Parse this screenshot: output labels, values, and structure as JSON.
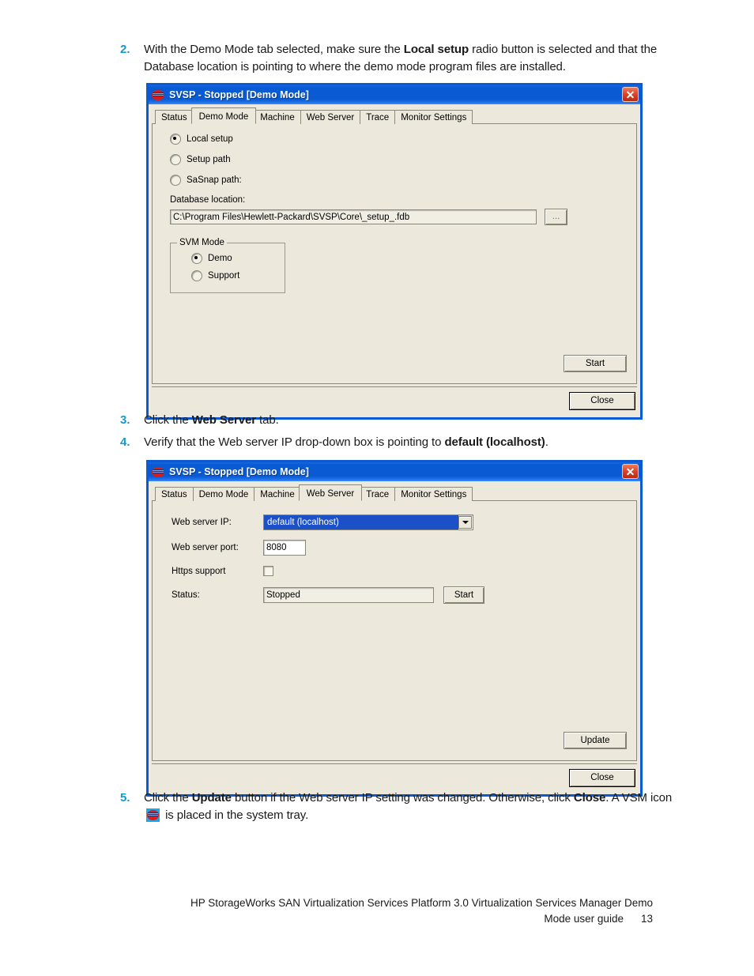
{
  "document": {
    "steps": [
      {
        "number": "2.",
        "segments": [
          {
            "t": "With the Demo Mode tab selected, make sure the ",
            "b": false
          },
          {
            "t": "Local setup",
            "b": true
          },
          {
            "t": " radio button is selected and that the Database location is pointing to where the demo mode program files are installed.",
            "b": false
          }
        ]
      },
      {
        "number": "3.",
        "segments": [
          {
            "t": "Click the ",
            "b": false
          },
          {
            "t": "Web Server",
            "b": true
          },
          {
            "t": " tab.",
            "b": false
          }
        ]
      },
      {
        "number": "4.",
        "segments": [
          {
            "t": "Verify that the Web server IP drop-down box is pointing to ",
            "b": false
          },
          {
            "t": "default (localhost)",
            "b": true
          },
          {
            "t": ".",
            "b": false
          }
        ]
      },
      {
        "number": "5.",
        "segments": [
          {
            "t": "Click the ",
            "b": false
          },
          {
            "t": "Update",
            "b": true
          },
          {
            "t": " button if the Web server IP setting was changed. Otherwise, click ",
            "b": false
          },
          {
            "t": "Close",
            "b": true
          },
          {
            "t": ". A VSM icon ",
            "b": false
          },
          {
            "t": "[vsm-tray-icon]",
            "b": false,
            "icon": true
          },
          {
            "t": " is placed in the system tray.",
            "b": false
          }
        ]
      }
    ],
    "footer": {
      "line1": "HP StorageWorks SAN Virtualization Services Platform 3.0 Virtualization Services Manager Demo",
      "line2": "Mode user guide",
      "page_number": "13"
    }
  },
  "dialog_demo_mode": {
    "title": "SVSP - Stopped [Demo Mode]",
    "app_icon": "svsp-icon",
    "close_button_glyph": "✕",
    "tabs": [
      {
        "label": "Status",
        "selected": false
      },
      {
        "label": "Demo Mode",
        "selected": true
      },
      {
        "label": "Machine",
        "selected": false
      },
      {
        "label": "Web Server",
        "selected": false
      },
      {
        "label": "Trace",
        "selected": false
      },
      {
        "label": "Monitor Settings",
        "selected": false
      }
    ],
    "setup_radios": [
      {
        "label": "Local setup",
        "checked": true
      },
      {
        "label": "Setup path",
        "checked": false
      },
      {
        "label": "SaSnap path:",
        "checked": false
      }
    ],
    "database_location_label": "Database location:",
    "database_location_value": "C:\\Program Files\\Hewlett-Packard\\SVSP\\Core\\_setup_.fdb",
    "browse_button_label": "...",
    "svm_mode": {
      "title": "SVM Mode",
      "options": [
        {
          "label": "Demo",
          "checked": true
        },
        {
          "label": "Support",
          "checked": false
        }
      ]
    },
    "start_button_label": "Start",
    "close_button_label": "Close"
  },
  "dialog_web_server": {
    "title": "SVSP - Stopped [Demo Mode]",
    "app_icon": "svsp-icon",
    "close_button_glyph": "✕",
    "tabs": [
      {
        "label": "Status",
        "selected": false
      },
      {
        "label": "Demo Mode",
        "selected": false
      },
      {
        "label": "Machine",
        "selected": false
      },
      {
        "label": "Web Server",
        "selected": true
      },
      {
        "label": "Trace",
        "selected": false
      },
      {
        "label": "Monitor Settings",
        "selected": false
      }
    ],
    "fields": {
      "web_server_ip_label": "Web server IP:",
      "web_server_ip_value": "default (localhost)",
      "web_server_port_label": "Web server port:",
      "web_server_port_value": "8080",
      "https_support_label": "Https support",
      "https_support_checked": false,
      "status_label": "Status:",
      "status_value": "Stopped",
      "start_button_label": "Start"
    },
    "update_button_label": "Update",
    "close_button_label": "Close"
  },
  "colors": {
    "step_number": "#0f9bd0",
    "titlebar_blue": "#0a5bd3",
    "dialog_face": "#ece9dc",
    "combo_selection": "#1b50c8",
    "close_button_red": "#d9452a"
  }
}
